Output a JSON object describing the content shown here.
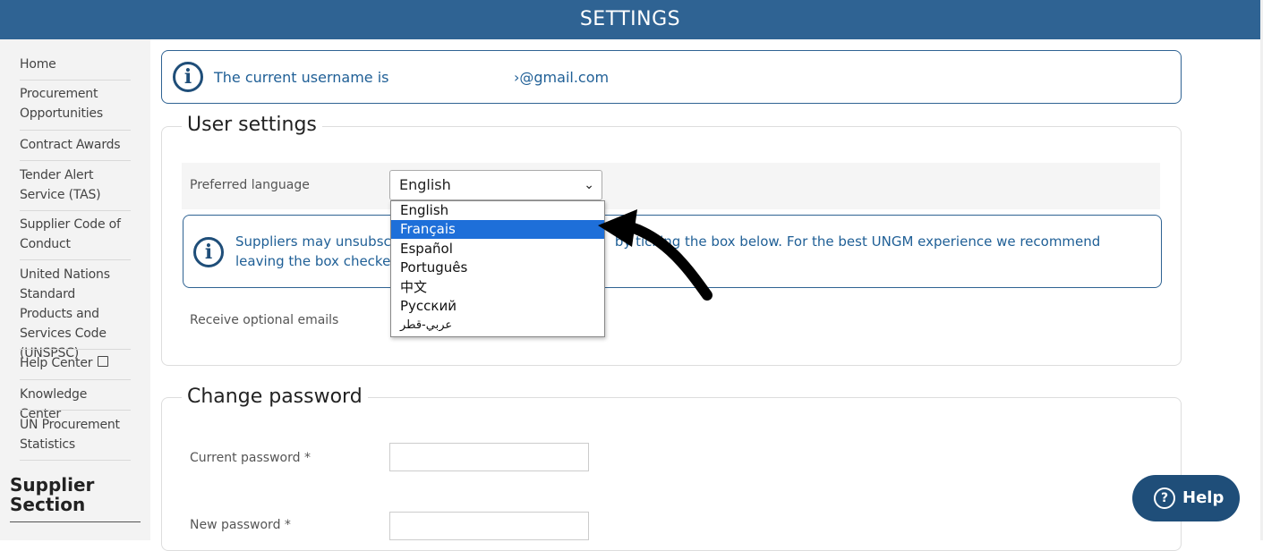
{
  "header": {
    "title": "SETTINGS"
  },
  "sidebar": {
    "items": [
      {
        "label": "Home"
      },
      {
        "label": "Procurement Opportunities"
      },
      {
        "label": "Contract Awards"
      },
      {
        "label": "Tender Alert Service (TAS)"
      },
      {
        "label": "Supplier Code of Conduct"
      },
      {
        "label": "United Nations Standard Products and Services Code (UNSPSC)"
      },
      {
        "label": "Help Center",
        "icon": "external-link-icon"
      },
      {
        "label": "Knowledge Center"
      },
      {
        "label": "UN Procurement Statistics"
      }
    ],
    "section_heading": "Supplier Section"
  },
  "username_info": {
    "text": "The current username is",
    "email_visible": "›@gmail.com",
    "icon": "info-icon"
  },
  "user_settings": {
    "legend": "User settings",
    "preferred_language_label": "Preferred language",
    "language_select": {
      "value": "English",
      "options": [
        "English",
        "Français",
        "Español",
        "Português",
        "中文",
        "Русский",
        "عربي-قطر"
      ],
      "highlighted": "Français"
    },
    "notice": {
      "text_before": "Suppliers may unsubscr",
      "text_after": "by ticking the box below. For the best UNGM experience we recommend",
      "text_line2": "leaving the box checked"
    },
    "optional_emails_label": "Receive optional emails"
  },
  "change_password": {
    "legend": "Change password",
    "current_password_label": "Current password *",
    "new_password_label": "New password *"
  },
  "help_button": {
    "label": "Help",
    "icon": "question-circle-icon"
  },
  "colors": {
    "brand": "#2f6393",
    "accent_text": "#1f5f96",
    "selection": "#1e6fd9"
  }
}
